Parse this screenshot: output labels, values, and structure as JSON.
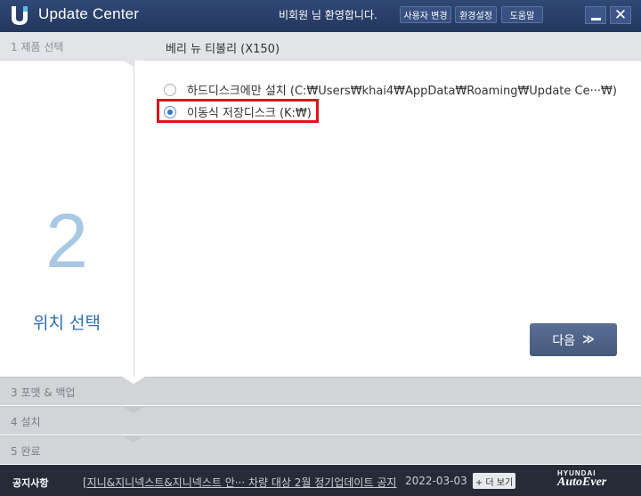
{
  "header": {
    "app_title": "Update Center",
    "welcome": "비회원 님 환영합니다.",
    "buttons": {
      "change_user": "사용자 변경",
      "settings": "환경설정",
      "help": "도움말"
    }
  },
  "steps": {
    "step1": {
      "label": "1  제품 선택",
      "product": "베리 뉴 티볼리 (X150)"
    },
    "step2": {
      "number": "2",
      "title": "위치 선택"
    },
    "step3": {
      "label": "3  포맷 & 백업"
    },
    "step4": {
      "label": "4  설치"
    },
    "step5": {
      "label": "5  완료"
    }
  },
  "options": [
    {
      "label": "하드디스크에만 설치 (C:₩Users₩khai4₩AppData₩Roaming₩Update  Ce···₩)",
      "selected": false
    },
    {
      "label": "이동식 저장디스크 (K:₩)",
      "selected": true
    }
  ],
  "next_button": {
    "label": "다음",
    "icon": "double-chevron-down-icon"
  },
  "footer": {
    "notice_label": "공지사항",
    "notice_text": "[지니&지니넥스트&지니넥스트  안··· 차량 대상 2월 정기업데이트 공지",
    "date": "2022-03-03",
    "more": "+ 더 보기",
    "brand_top": "HYUNDAI",
    "brand_bottom": "AutoEver"
  },
  "colors": {
    "titlebar": "#2f4876",
    "accent": "#2d6fb4",
    "highlight": "#e0141a"
  }
}
